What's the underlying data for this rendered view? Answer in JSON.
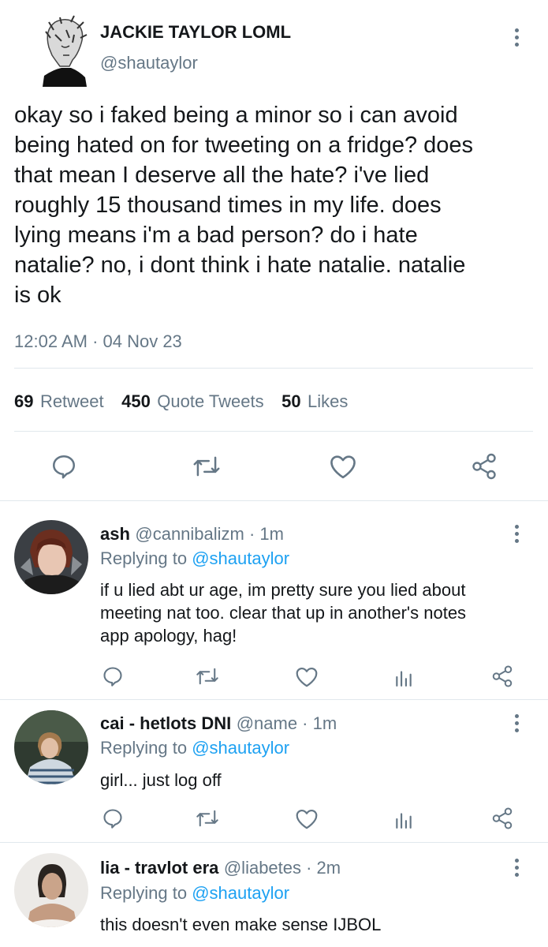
{
  "main_tweet": {
    "display_name": "JACKIE TAYLOR LOML",
    "handle": "@shautaylor",
    "text_lines": [
      "okay so i faked being a minor so i can avoid",
      "being hated on for tweeting on a fridge? does",
      "that mean I deserve all the hate? i've lied",
      "roughly 15 thousand times in my life. does",
      "lying means i'm a bad person? do i hate",
      "natalie? no, i dont think i hate natalie. natalie",
      "is ok"
    ],
    "timestamp": "12:02 AM · 04 Nov 23",
    "stats": {
      "retweets_count": "69",
      "retweets_label": "Retweet",
      "quotes_count": "450",
      "quotes_label": "Quote Tweets",
      "likes_count": "50",
      "likes_label": "Likes"
    }
  },
  "replies": [
    {
      "name": "ash",
      "meta": "@cannibalizm · 1m",
      "replying_prefix": "Replying to",
      "replying_handle": "@shautaylor",
      "text_lines": [
        "if u lied abt ur age, im pretty sure you lied about",
        "meeting nat too. clear that up in another's notes",
        "app apology, hag!"
      ]
    },
    {
      "name": "cai - hetlots DNI",
      "meta": "@name · 1m",
      "replying_prefix": "Replying to",
      "replying_handle": "@shautaylor",
      "text_lines": [
        "girl... just log off"
      ]
    },
    {
      "name": "lia - travlot era",
      "meta": "@liabetes · 2m",
      "replying_prefix": "Replying to",
      "replying_handle": "@shautaylor",
      "text_lines": [
        "this doesn't even make sense IJBOL"
      ]
    }
  ],
  "icons": {
    "reply": "reply-icon",
    "retweet": "retweet-icon",
    "like": "heart-icon",
    "share": "share-icon",
    "analytics": "analytics-icon",
    "more": "more-vertical-icon"
  },
  "colors": {
    "text": "#14171a",
    "secondary": "#657786",
    "link": "#1da1f2",
    "divider": "#e1e8ed"
  }
}
